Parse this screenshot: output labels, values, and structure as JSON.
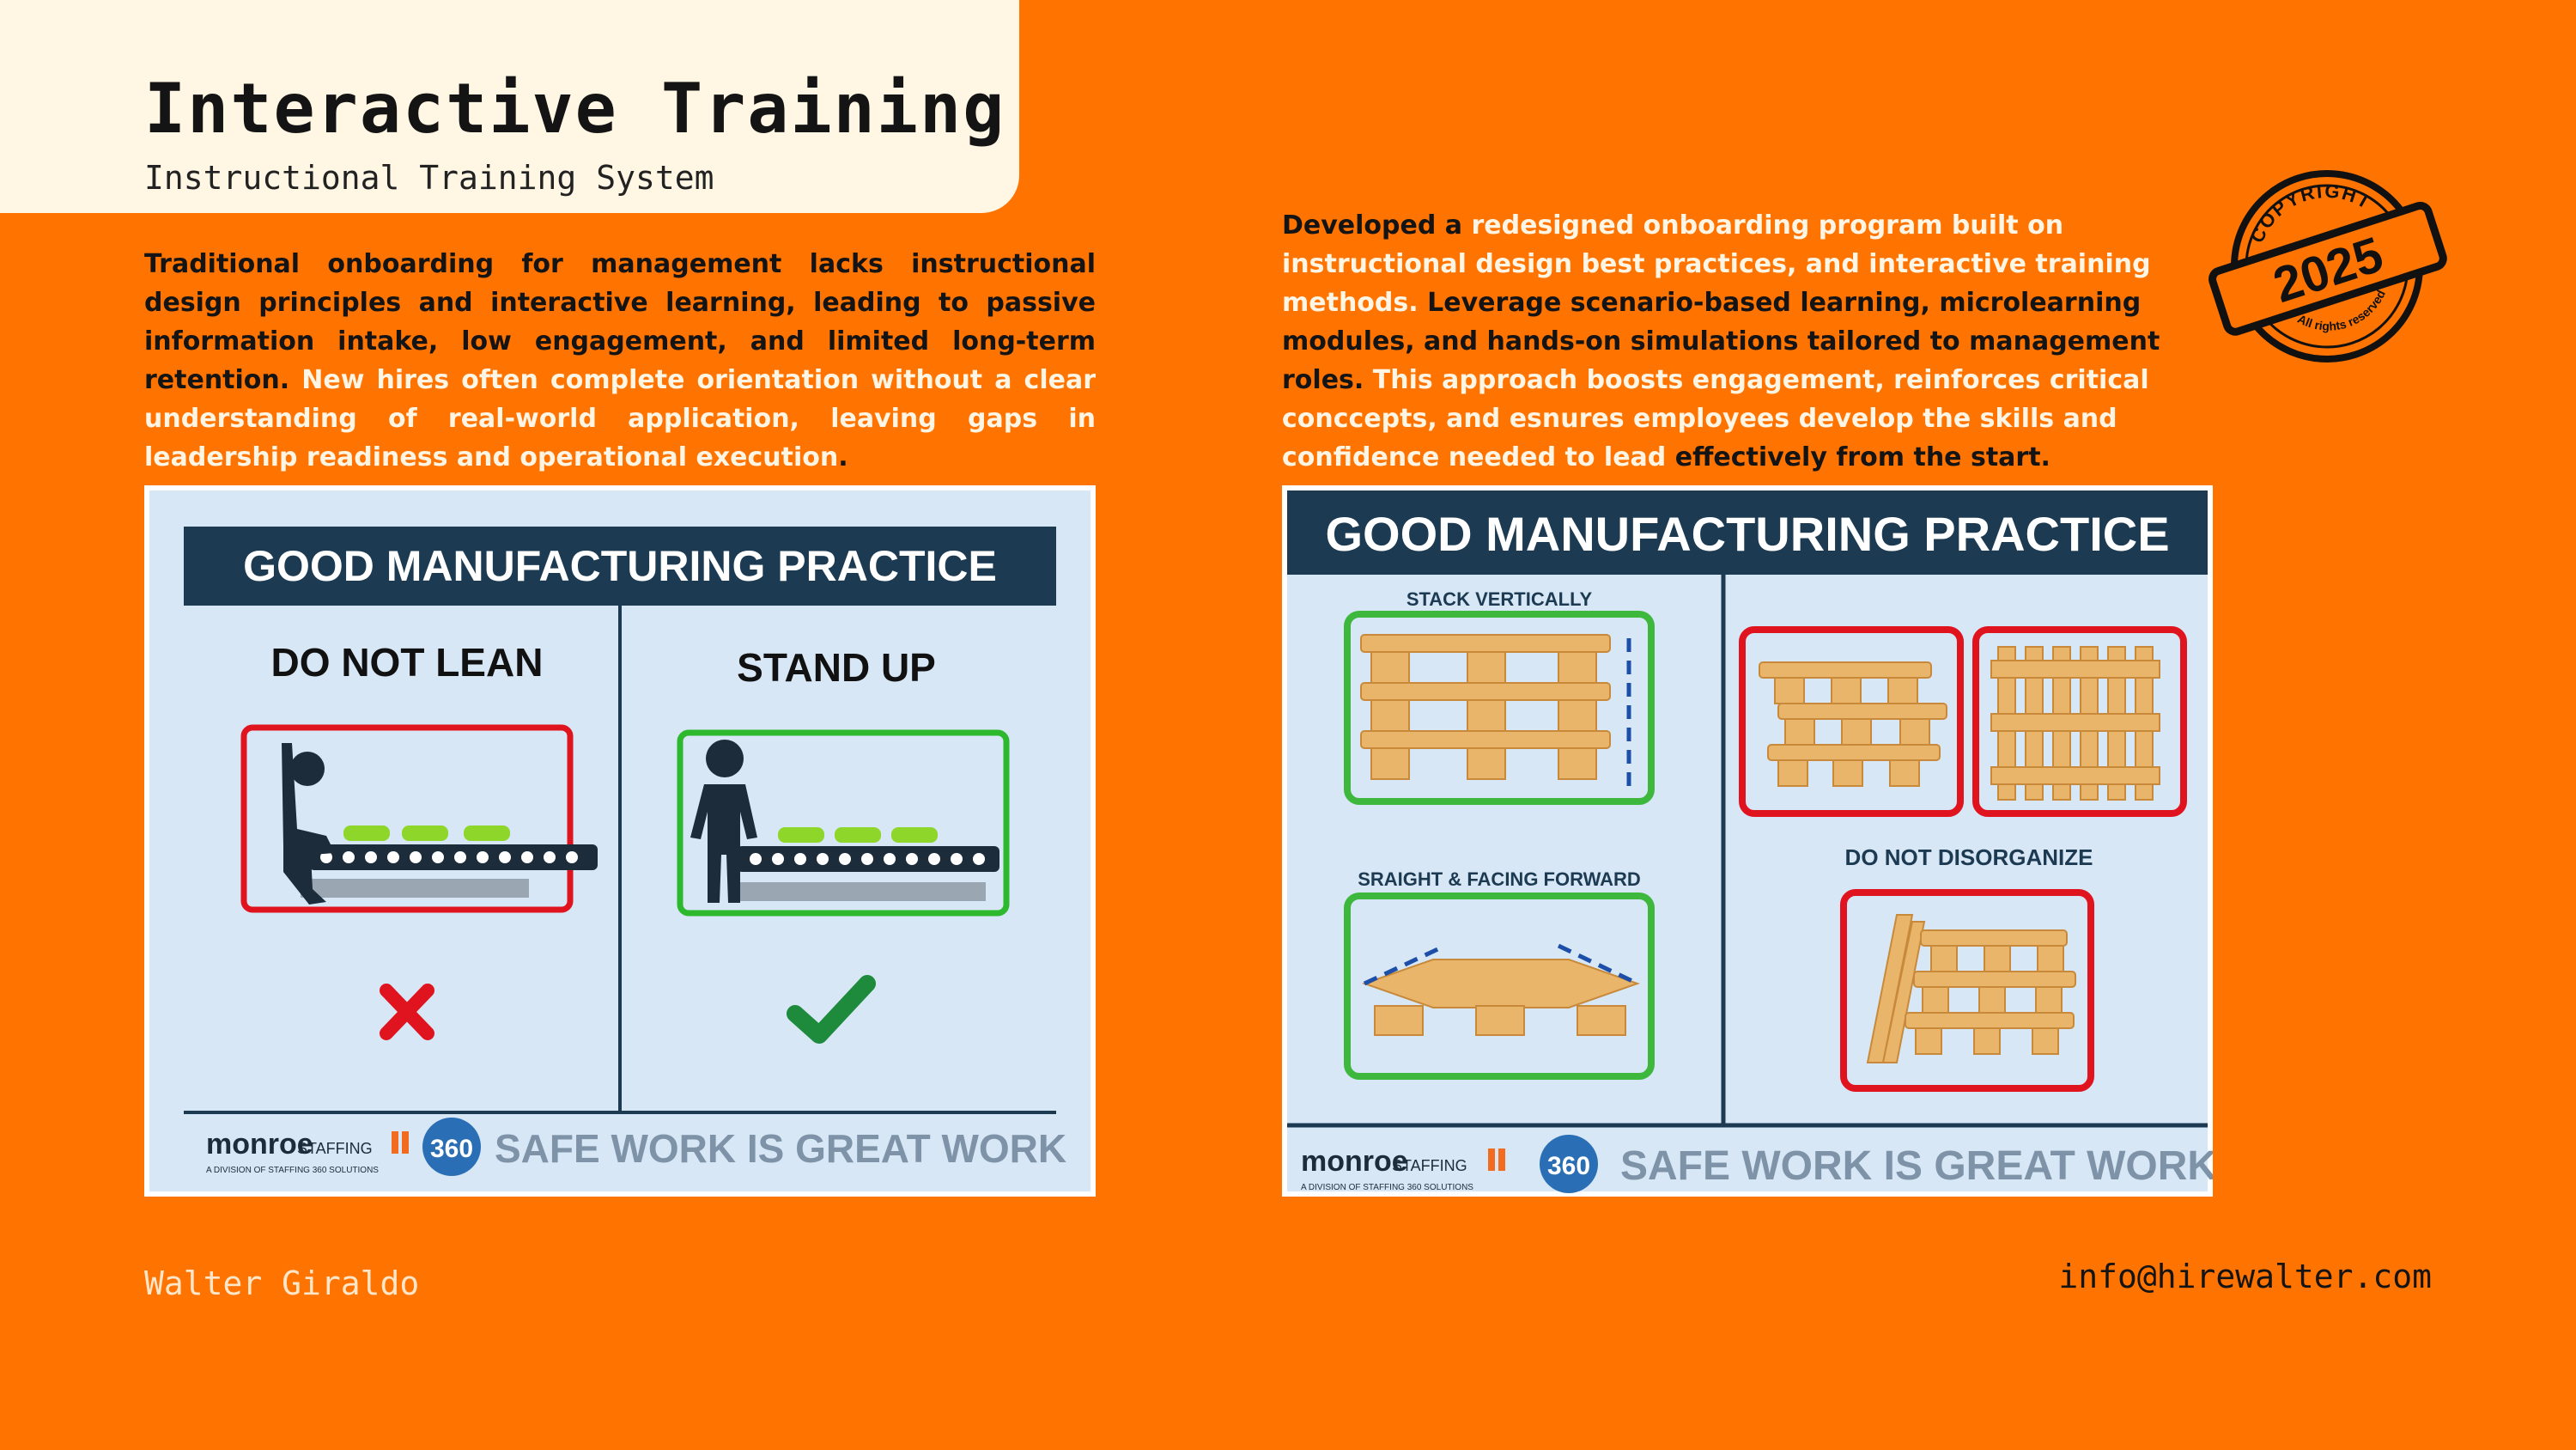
{
  "header": {
    "title": "Interactive Training",
    "subtitle": "Instructional Training System"
  },
  "left_text": {
    "dark": "Traditional onboarding for management lacks instructional design principles and interactive learning, leading to passive information intake, low engagement, and limited long-term retention. ",
    "light": "New hires often complete orientation without a clear understanding of real-world application, leaving gaps in leadership readiness and operational execution",
    "end": "."
  },
  "right_text": {
    "s1_dark": "Developed a ",
    "s1_light": "redesigned onboarding program built on instructional design best practices, and interactive training methods.",
    "s2_dark": " Leverage scenario-based learning, microlearning modules, and hands-on simulations tailored to management roles.",
    "s3_light": " This approach boosts engagement, reinforces critical conccepts, and esnures employees develop the skills and confidence needed to lead",
    "s4_dark": " effectively from the start."
  },
  "poster_left": {
    "banner": "GOOD MANUFACTURING PRACTICE",
    "left_heading": "DO NOT LEAN",
    "right_heading": "STAND UP",
    "footer": {
      "brand": "monroe",
      "brand_sub": "STAFFING",
      "division": "A DIVISION OF STAFFING 360 SOLUTIONS",
      "badge": "360",
      "slogan": "SAFE WORK IS GREAT WORK"
    },
    "icons": [
      "leaning-worker-icon",
      "standing-worker-icon",
      "x-mark-icon",
      "check-mark-icon"
    ],
    "colors": {
      "bad": "#E0141E",
      "good": "#2DB82D",
      "navy": "#1C3A52",
      "light_bg": "#D7E7F5"
    }
  },
  "poster_right": {
    "banner": "GOOD MANUFACTURING PRACTICE",
    "label_stack": "STACK VERTICALLY",
    "label_straight": "SRAIGHT & FACING FORWARD",
    "label_disorganize": "DO NOT DISORGANIZE",
    "footer": {
      "brand": "monroe",
      "brand_sub": "STAFFING",
      "division": "A DIVISION OF STAFFING 360 SOLUTIONS",
      "badge": "360",
      "slogan": "SAFE WORK IS GREAT WORK"
    },
    "icons": [
      "stacked-pallets-icon",
      "pallet-straight-icon",
      "pallet-offset-icon",
      "pallet-vertical-icon",
      "pallet-messy-icon"
    ]
  },
  "stamp": {
    "top": "COPYRIGHT",
    "year": "2025",
    "bottom": "All rights reserved"
  },
  "footer": {
    "name": "Walter Giraldo",
    "email": "info@hirewalter.com"
  },
  "colors": {
    "background": "#FF7300",
    "card": "#FFF6E3",
    "highlight_text": "#FFF5E4"
  }
}
